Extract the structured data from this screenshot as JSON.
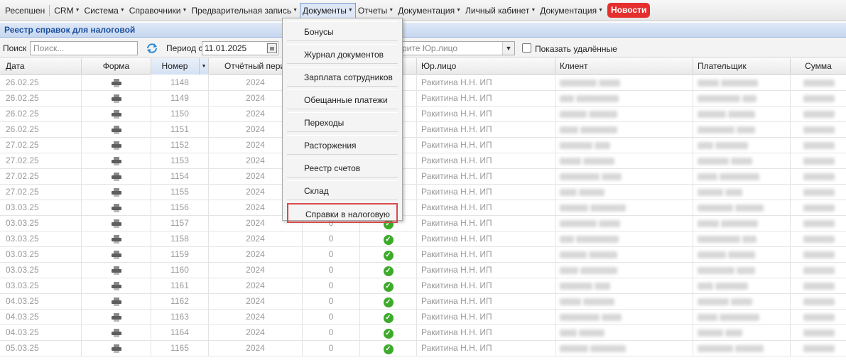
{
  "menu": {
    "items": [
      {
        "label": "Ресепшен",
        "has_caret": false
      },
      {
        "label": "CRM",
        "has_caret": true
      },
      {
        "label": "Система",
        "has_caret": true
      },
      {
        "label": "Справочники",
        "has_caret": true
      },
      {
        "label": "Предварительная запись",
        "has_caret": true
      },
      {
        "label": "Документы",
        "has_caret": true,
        "active": true
      },
      {
        "label": "Отчеты",
        "has_caret": true
      },
      {
        "label": "Документация",
        "has_caret": true
      },
      {
        "label": "Личный кабинет",
        "has_caret": true
      },
      {
        "label": "Документация",
        "has_caret": true
      }
    ],
    "news_label": "Новости",
    "news_color": "#e52f2f"
  },
  "panel": {
    "title": "Реестр справок для налоговой"
  },
  "toolbar": {
    "search_label": "Поиск",
    "search_placeholder": "Поиск...",
    "period_label": "Период с",
    "period_from": "11.01.2025",
    "entity_placeholder": "рите Юр.лицо",
    "show_deleted_label": "Показать удалённые"
  },
  "dropdown": {
    "items": [
      "Бонусы",
      "Журнал документов",
      "Зарплата сотрудников",
      "Обещанные платежи",
      "Переходы",
      "Расторжения",
      "Реестр счетов",
      "Склад",
      "Справки в налоговую"
    ],
    "highlighted": "Справки в налоговую"
  },
  "table": {
    "columns": [
      "Дата",
      "Форма",
      "Номер",
      "Отчётный период",
      "",
      "",
      "Юр.лицо",
      "Клиент",
      "Плательщик",
      "Сумма"
    ],
    "rows": [
      {
        "date": "26.02.25",
        "number": "1148",
        "period": "2024",
        "col4": "",
        "status": false,
        "entity": "Ракитина Н.Н. ИП"
      },
      {
        "date": "26.02.25",
        "number": "1149",
        "period": "2024",
        "col4": "",
        "status": false,
        "entity": "Ракитина Н.Н. ИП"
      },
      {
        "date": "26.02.25",
        "number": "1150",
        "period": "2024",
        "col4": "",
        "status": false,
        "entity": "Ракитина Н.Н. ИП"
      },
      {
        "date": "26.02.25",
        "number": "1151",
        "period": "2024",
        "col4": "",
        "status": false,
        "entity": "Ракитина Н.Н. ИП"
      },
      {
        "date": "27.02.25",
        "number": "1152",
        "period": "2024",
        "col4": "",
        "status": false,
        "entity": "Ракитина Н.Н. ИП"
      },
      {
        "date": "27.02.25",
        "number": "1153",
        "period": "2024",
        "col4": "",
        "status": false,
        "entity": "Ракитина Н.Н. ИП"
      },
      {
        "date": "27.02.25",
        "number": "1154",
        "period": "2024",
        "col4": "",
        "status": false,
        "entity": "Ракитина Н.Н. ИП"
      },
      {
        "date": "27.02.25",
        "number": "1155",
        "period": "2024",
        "col4": "",
        "status": false,
        "entity": "Ракитина Н.Н. ИП"
      },
      {
        "date": "03.03.25",
        "number": "1156",
        "period": "2024",
        "col4": "",
        "status": false,
        "entity": "Ракитина Н.Н. ИП"
      },
      {
        "date": "03.03.25",
        "number": "1157",
        "period": "2024",
        "col4": "0",
        "status": true,
        "entity": "Ракитина Н.Н. ИП"
      },
      {
        "date": "03.03.25",
        "number": "1158",
        "period": "2024",
        "col4": "0",
        "status": true,
        "entity": "Ракитина Н.Н. ИП"
      },
      {
        "date": "03.03.25",
        "number": "1159",
        "period": "2024",
        "col4": "0",
        "status": true,
        "entity": "Ракитина Н.Н. ИП"
      },
      {
        "date": "03.03.25",
        "number": "1160",
        "period": "2024",
        "col4": "0",
        "status": true,
        "entity": "Ракитина Н.Н. ИП"
      },
      {
        "date": "03.03.25",
        "number": "1161",
        "period": "2024",
        "col4": "0",
        "status": true,
        "entity": "Ракитина Н.Н. ИП"
      },
      {
        "date": "04.03.25",
        "number": "1162",
        "period": "2024",
        "col4": "0",
        "status": true,
        "entity": "Ракитина Н.Н. ИП"
      },
      {
        "date": "04.03.25",
        "number": "1163",
        "period": "2024",
        "col4": "0",
        "status": true,
        "entity": "Ракитина Н.Н. ИП"
      },
      {
        "date": "04.03.25",
        "number": "1164",
        "period": "2024",
        "col4": "0",
        "status": true,
        "entity": "Ракитина Н.Н. ИП"
      },
      {
        "date": "05.03.25",
        "number": "1165",
        "period": "2024",
        "col4": "0",
        "status": true,
        "entity": "Ракитина Н.Н. ИП"
      }
    ]
  }
}
